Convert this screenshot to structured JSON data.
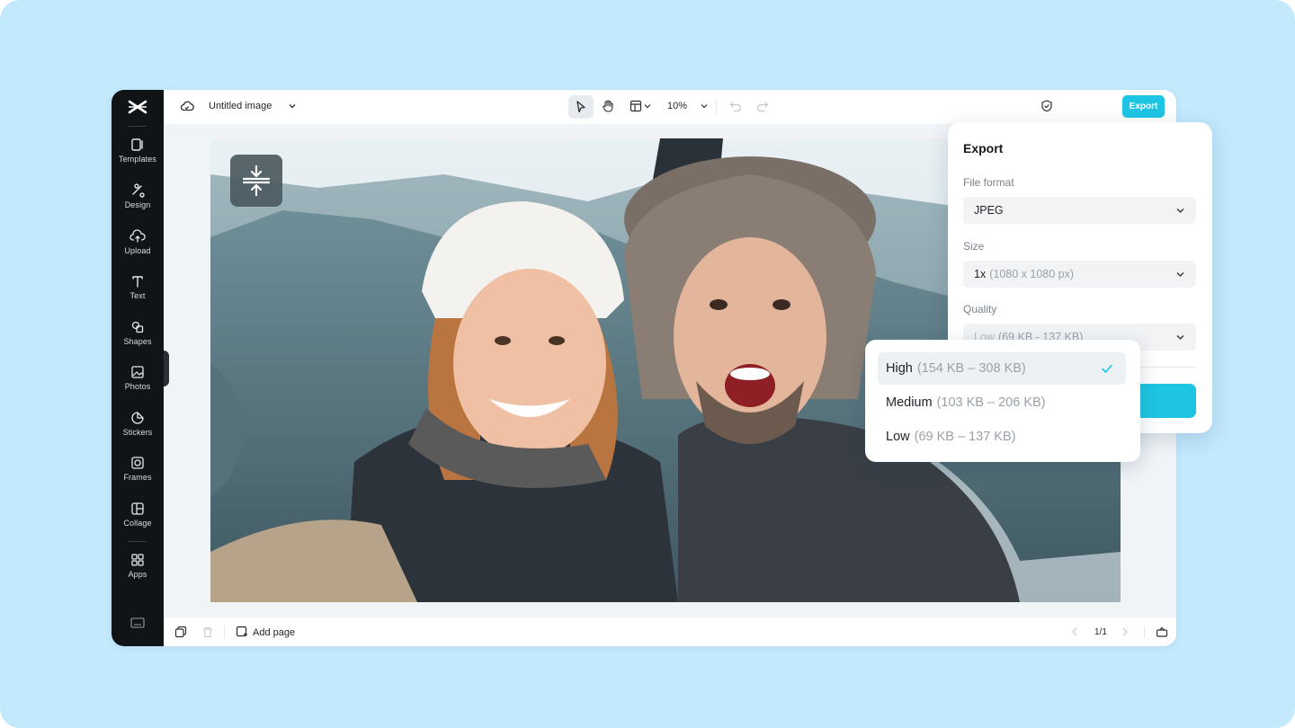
{
  "app": {
    "title": "Untitled image",
    "zoom": "10%",
    "export_label": "Export",
    "accent_color": "#1ec5e3"
  },
  "sidebar": {
    "items": [
      {
        "label": "Templates",
        "icon": "templates-icon"
      },
      {
        "label": "Design",
        "icon": "design-icon"
      },
      {
        "label": "Upload",
        "icon": "upload-icon"
      },
      {
        "label": "Text",
        "icon": "text-icon"
      },
      {
        "label": "Shapes",
        "icon": "shapes-icon"
      },
      {
        "label": "Photos",
        "icon": "photos-icon"
      },
      {
        "label": "Stickers",
        "icon": "stickers-icon"
      },
      {
        "label": "Frames",
        "icon": "frames-icon"
      },
      {
        "label": "Collage",
        "icon": "collage-icon"
      },
      {
        "label": "Apps",
        "icon": "apps-icon"
      }
    ]
  },
  "bottombar": {
    "add_page_label": "Add page",
    "page_indicator": "1/1"
  },
  "export_panel": {
    "title": "Export",
    "file_format_label": "File format",
    "file_format_value": "JPEG",
    "size_label": "Size",
    "size_value": "1x",
    "size_detail": "(1080 x 1080 px)",
    "quality_label": "Quality",
    "quality_value": "Low",
    "quality_detail": "(69 KB - 137 KB)"
  },
  "quality_dropdown": {
    "options": [
      {
        "label": "High",
        "range": "(154 KB – 308 KB)",
        "selected": true
      },
      {
        "label": "Medium",
        "range": "(103 KB – 206 KB)",
        "selected": false
      },
      {
        "label": "Low",
        "range": "(69 KB – 137 KB)",
        "selected": false
      }
    ]
  },
  "canvas": {
    "image_subject": "selfie of a smiling couple in winter hats on a mountain"
  }
}
